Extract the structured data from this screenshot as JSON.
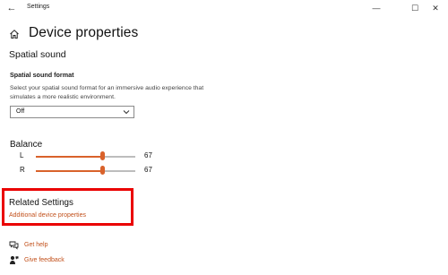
{
  "window": {
    "title": "Settings",
    "back_glyph": "←",
    "minimize_glyph": "—",
    "maximize_glyph": "☐",
    "close_glyph": "✕"
  },
  "page": {
    "title": "Device properties",
    "home_icon": "home-icon"
  },
  "spatial": {
    "section_title": "Spatial sound",
    "field_label": "Spatial sound format",
    "description": "Select your spatial sound format for an immersive audio experience that simulates a more realistic environment.",
    "selected": "Off"
  },
  "balance": {
    "title": "Balance",
    "channels": [
      {
        "label": "L",
        "value": "67",
        "level": 0.67
      },
      {
        "label": "R",
        "value": "67",
        "level": 0.67
      }
    ]
  },
  "related": {
    "title": "Related Settings",
    "link": "Additional device properties"
  },
  "help": {
    "get_help": "Get help",
    "give_feedback": "Give feedback"
  },
  "colors": {
    "accent": "#d9622b",
    "link": "#c2501b",
    "highlight": "#ea0000"
  }
}
